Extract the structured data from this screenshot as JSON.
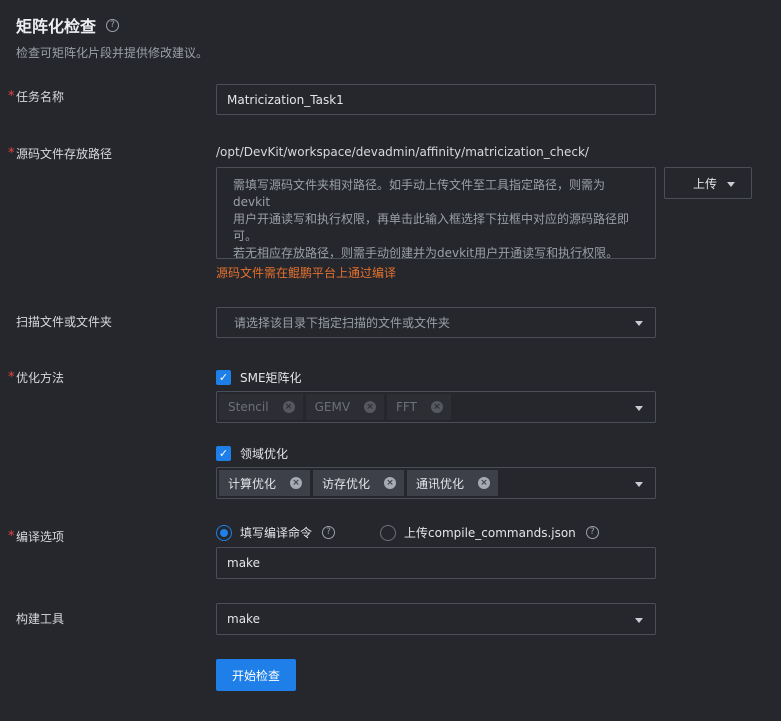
{
  "header": {
    "title": "矩阵化检查",
    "subtitle": "检查可矩阵化片段并提供修改建议。"
  },
  "form": {
    "task_name": {
      "label": "任务名称",
      "value": "Matricization_Task1"
    },
    "source_path": {
      "label": "源码文件存放路径",
      "path": "/opt/DevKit/workspace/devadmin/affinity/matricization_check/",
      "hint_line1": "需填写源码文件夹相对路径。如手动上传文件至工具指定路径，则需为devkit",
      "hint_line2": "用户开通读写和执行权限，再单击此输入框选择下拉框中对应的源码路径即",
      "hint_line3": "可。",
      "hint_line4": "若无相应存放路径，则需手动创建并为devkit用户开通读写和执行权限。",
      "upload_label": "上传",
      "warning": "源码文件需在鲲鹏平台上通过编译"
    },
    "scan": {
      "label": "扫描文件或文件夹",
      "placeholder": "请选择该目录下指定扫描的文件或文件夹"
    },
    "optimization": {
      "label": "优化方法",
      "sme_label": "SME矩阵化",
      "sme_tags": [
        "Stencil",
        "GEMV",
        "FFT"
      ],
      "domain_label": "领域优化",
      "domain_tags": [
        "计算优化",
        "访存优化",
        "通讯优化"
      ]
    },
    "compile": {
      "label": "编译选项",
      "option1": "填写编译命令",
      "option2": "上传compile_commands.json",
      "command": "make"
    },
    "build_tool": {
      "label": "构建工具",
      "value": "make"
    },
    "submit_label": "开始检查"
  },
  "colors": {
    "background": "#25272c",
    "accent": "#1e7fe8",
    "required": "#e54545",
    "warning": "#e3702f"
  }
}
